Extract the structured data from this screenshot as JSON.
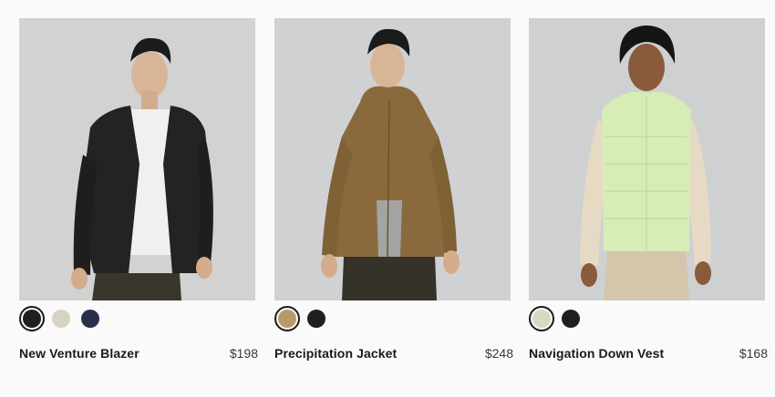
{
  "products": [
    {
      "name": "New Venture Blazer",
      "price": "$198",
      "swatches": [
        {
          "color": "#1f1f1f",
          "selected": true
        },
        {
          "color": "#d8d2c4",
          "selected": false
        },
        {
          "color": "#26304a",
          "selected": false
        }
      ],
      "photo_colors": {
        "bg": "#d2d2d3",
        "garment": "#232323",
        "inner": "#f0f0ee",
        "pants": "#3b362c"
      }
    },
    {
      "name": "Precipitation Jacket",
      "price": "$248",
      "swatches": [
        {
          "color": "#b89a6a",
          "selected": true
        },
        {
          "color": "#1f1f1f",
          "selected": false
        }
      ],
      "photo_colors": {
        "bg": "#d0d1d2",
        "garment": "#8a6a3c",
        "inner": "#a3a5a4",
        "pants": "#35322a"
      }
    },
    {
      "name": "Navigation Down Vest",
      "price": "$168",
      "swatches": [
        {
          "color": "#d2dcc2",
          "selected": true
        },
        {
          "color": "#1f1f1f",
          "selected": false
        }
      ],
      "photo_colors": {
        "bg": "#cfd0d1",
        "garment": "#d7ecb7",
        "inner": "#e6dac4",
        "pants": "#d3c6aa"
      }
    }
  ]
}
